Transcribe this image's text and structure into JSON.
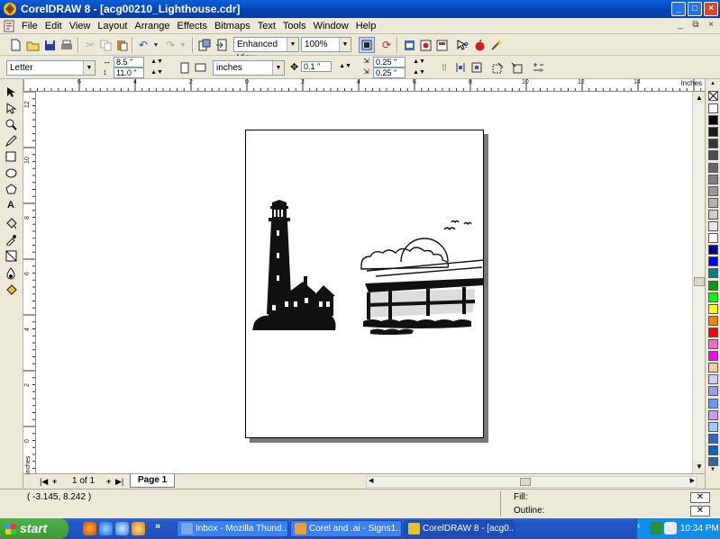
{
  "window": {
    "title": "CorelDRAW 8 - [acg00210_Lighthouse.cdr]",
    "controls": [
      "_",
      "□",
      "×"
    ]
  },
  "menu": {
    "items": [
      "File",
      "Edit",
      "View",
      "Layout",
      "Arrange",
      "Effects",
      "Bitmaps",
      "Text",
      "Tools",
      "Window",
      "Help"
    ],
    "doc_controls": [
      "_",
      "⧉",
      "×"
    ]
  },
  "toolbar1": {
    "view_mode": "Enhanced View",
    "zoom": "100%"
  },
  "propertybar": {
    "paper_size": "Letter",
    "width": "8.5 \"",
    "height": "11.0 \"",
    "units": "inches",
    "nudge": "0.1 \"",
    "dup_x": "0.25 \"",
    "dup_y": "0.25 \""
  },
  "ruler": {
    "unit": "inches",
    "h_ticks": [
      "6",
      "4",
      "2",
      "0",
      "2",
      "4",
      "6",
      "8",
      "10",
      "12",
      "14"
    ],
    "v_ticks": [
      "12",
      "10",
      "8",
      "6",
      "4",
      "2",
      "0"
    ]
  },
  "pagenav": {
    "count": "1 of 1",
    "tab": "Page 1",
    "vertical_unit": "inches"
  },
  "status": {
    "coords": "( -3.145, 8.242 )",
    "fill_label": "Fill:",
    "outline_label": "Outline:"
  },
  "palette": {
    "colors": [
      "#ffffff",
      "#000000",
      "#1a1a1a",
      "#333333",
      "#4d4d4d",
      "#666666",
      "#808080",
      "#999999",
      "#b3b3b3",
      "#cccccc",
      "#e6e6e6",
      "#ffffff",
      "#000080",
      "#0000ff",
      "#008080",
      "#00a000",
      "#00ff00",
      "#ffff00",
      "#ff8000",
      "#ff0000",
      "#ff66cc",
      "#ff00ff",
      "#ffcc99",
      "#ccccff",
      "#9999ff",
      "#6699ff",
      "#cc99ff",
      "#99ccff",
      "#3366cc",
      "#0066cc",
      "#336699"
    ]
  },
  "taskbar": {
    "start_label": "start",
    "tasks": [
      {
        "label": "Inbox - Mozilla Thund...",
        "active": false
      },
      {
        "label": "Corel and .ai - Signs1...",
        "active": false
      },
      {
        "label": "CorelDRAW 8 - [acg0...",
        "active": true
      }
    ],
    "clock": "10:34 PM"
  }
}
